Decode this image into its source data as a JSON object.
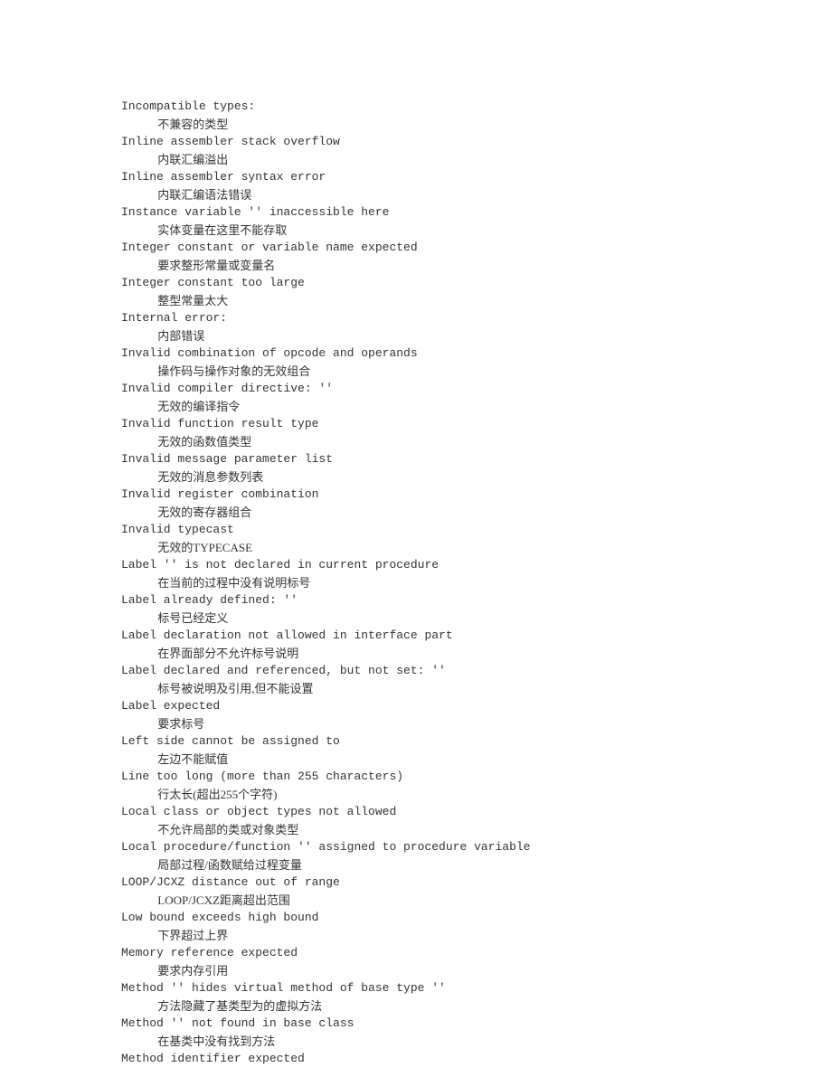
{
  "entries": [
    {
      "en": "Incompatible types:",
      "zh": "不兼容的类型"
    },
    {
      "en": "Inline assembler stack overflow",
      "zh": "内联汇编溢出"
    },
    {
      "en": "Inline assembler syntax error",
      "zh": "内联汇编语法错误"
    },
    {
      "en": "Instance variable '' inaccessible here",
      "zh": "实体变量在这里不能存取"
    },
    {
      "en": "Integer constant or variable name expected",
      "zh": "要求整形常量或变量名"
    },
    {
      "en": "Integer constant too large",
      "zh": "整型常量太大"
    },
    {
      "en": "Internal error:",
      "zh": "内部错误"
    },
    {
      "en": "Invalid combination of opcode and operands",
      "zh": "操作码与操作对象的无效组合"
    },
    {
      "en": "Invalid compiler directive: ''",
      "zh": "无效的编译指令"
    },
    {
      "en": "Invalid function result type",
      "zh": "无效的函数值类型"
    },
    {
      "en": "Invalid message parameter list",
      "zh": "无效的消息参数列表"
    },
    {
      "en": "Invalid register combination",
      "zh": "无效的寄存器组合"
    },
    {
      "en": "Invalid typecast",
      "zh": "无效的TYPECASE"
    },
    {
      "en": "Label '' is not declared in current procedure",
      "zh": "在当前的过程中没有说明标号"
    },
    {
      "en": "Label already defined: ''",
      "zh": "标号已经定义"
    },
    {
      "en": "Label declaration not allowed in interface part",
      "zh": "在界面部分不允许标号说明"
    },
    {
      "en": "Label declared and referenced, but not set: ''",
      "zh": "标号被说明及引用,但不能设置"
    },
    {
      "en": "Label expected",
      "zh": "要求标号"
    },
    {
      "en": "Left side cannot be assigned to",
      "zh": "左边不能赋值"
    },
    {
      "en": "Line too long (more than 255 characters)",
      "zh": "行太长(超出255个字符)"
    },
    {
      "en": "Local class or object types not allowed",
      "zh": "不允许局部的类或对象类型"
    },
    {
      "en": "Local procedure/function '' assigned to procedure variable",
      "zh": "局部过程/函数赋给过程变量"
    },
    {
      "en": "LOOP/JCXZ distance out of range",
      "zh": "LOOP/JCXZ距离超出范围"
    },
    {
      "en": "Low bound exceeds high bound",
      "zh": "下界超过上界"
    },
    {
      "en": "Memory reference expected",
      "zh": "要求内存引用"
    },
    {
      "en": "Method '' hides virtual method of base type ''",
      "zh": "方法隐藏了基类型为的虚拟方法"
    },
    {
      "en": "Method '' not found in base class",
      "zh": "在基类中没有找到方法"
    },
    {
      "en": "Method identifier expected",
      "zh": null
    }
  ]
}
